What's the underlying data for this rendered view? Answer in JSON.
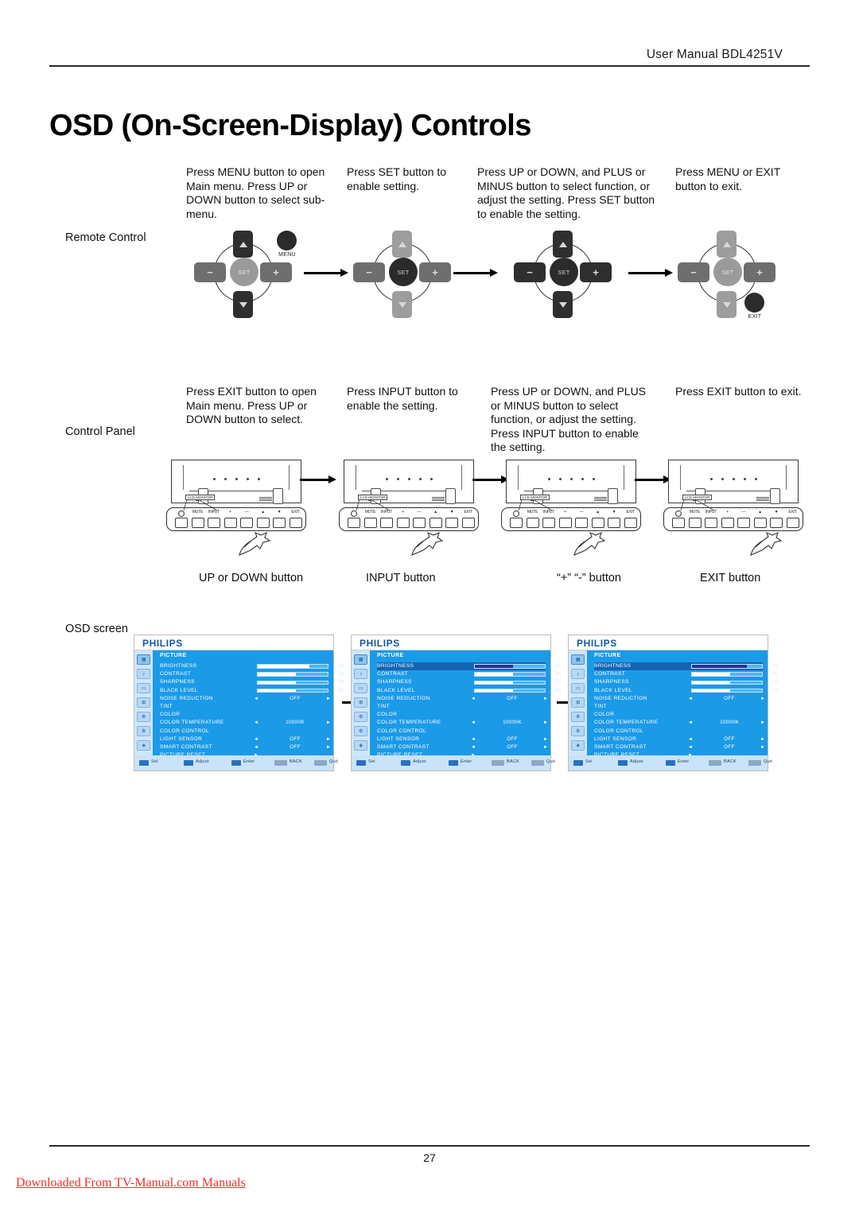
{
  "header": {
    "manual_line": "User Manual BDL4251V",
    "title": "OSD (On-Screen-Display) Controls"
  },
  "remote_section": {
    "row_label": "Remote Control",
    "steps": [
      "Press MENU button to open Main menu.   Press UP or DOWN button to select sub-menu.",
      "Press SET button to enable setting.",
      "Press UP or DOWN, and PLUS or MINUS button to select function, or adjust the setting. Press SET button to enable the setting.",
      "Press MENU or EXIT button to exit."
    ],
    "remotes": [
      {
        "extra_button": "MENU",
        "keys": {
          "up": "up-arrow",
          "down": "down-arrow",
          "left": "minus",
          "right": "plus",
          "center": "SET"
        }
      },
      {
        "extra_button": "",
        "keys": {
          "up": "up-arrow",
          "down": "down-arrow",
          "left": "minus",
          "right": "plus",
          "center": "SET"
        }
      },
      {
        "extra_button": "",
        "keys": {
          "up": "up-arrow",
          "down": "down-arrow",
          "left": "minus",
          "right": "plus",
          "center": "SET"
        }
      },
      {
        "extra_button": "EXIT",
        "keys": {
          "up": "up-arrow",
          "down": "down-arrow",
          "left": "minus",
          "right": "plus",
          "center": "SET"
        }
      }
    ]
  },
  "panel_section": {
    "row_label": "Control Panel",
    "steps": [
      "Press EXIT button to open Main menu. Press UP or DOWN button to select.",
      "Press INPUT button to enable the setting.",
      "Press UP or DOWN, and PLUS or MINUS button to select function, or adjust the setting. Press INPUT button to enable the setting.",
      "Press EXIT button to exit."
    ],
    "panel_buttons": [
      "⏻",
      "MUTE",
      "INPUT",
      "+",
      "—",
      "▲",
      "▼",
      "EXIT"
    ],
    "panel_tag": "LCD MONITOR",
    "captions": [
      "UP or DOWN button",
      "INPUT button",
      "“+” “-” button",
      "EXIT button"
    ]
  },
  "osd_section": {
    "row_label": "OSD screen",
    "brand": "PHILIPS",
    "menu_title": "PICTURE",
    "sidebar_icons": [
      "picture-icon",
      "audio-icon",
      "screen-icon",
      "pip-icon",
      "configuration1-icon",
      "configuration2-icon",
      "advanced-option-icon"
    ],
    "footer_keys": [
      {
        "chip": "updown-chip",
        "label": "Sel"
      },
      {
        "chip": "leftright-chip",
        "label": "Adjust"
      },
      {
        "chip": "set-chip",
        "label": "Enter"
      },
      {
        "chip": "exit-chip",
        "label": "BACK"
      },
      {
        "chip": "menu-chip",
        "label": "Quit"
      }
    ],
    "rows": [
      {
        "label": "BRIGHTNESS",
        "kind": "bar",
        "value": "50"
      },
      {
        "label": "CONTRAST",
        "kind": "bar",
        "value": "50"
      },
      {
        "label": "SHARPNESS",
        "kind": "bar",
        "value": "50"
      },
      {
        "label": "BLACK LEVEL",
        "kind": "bar",
        "value": "50"
      },
      {
        "label": "NOISE REDUCTION",
        "kind": "option",
        "value": "OFF"
      },
      {
        "label": "TINT",
        "kind": "plain",
        "value": ""
      },
      {
        "label": "COLOR",
        "kind": "plain",
        "value": ""
      },
      {
        "label": "COLOR TEMPERATURE",
        "kind": "option",
        "value": "10000K"
      },
      {
        "label": "COLOR CONTROL",
        "kind": "plain",
        "value": ""
      },
      {
        "label": "LIGHT SENSOR",
        "kind": "option",
        "value": "OFF"
      },
      {
        "label": "SMART CONTRAST",
        "kind": "option",
        "value": "OFF"
      },
      {
        "label": "PICTURE RESET",
        "kind": "submenu",
        "value": ""
      }
    ],
    "screens": [
      {
        "name": "osd-screen-1",
        "highlight_row": -1,
        "brightness_value": "50",
        "brightness_pct": 74,
        "brightness_selected": false
      },
      {
        "name": "osd-screen-2",
        "highlight_row": 0,
        "brightness_value": "50",
        "brightness_pct": 55,
        "brightness_selected": true
      },
      {
        "name": "osd-screen-3",
        "highlight_row": 0,
        "brightness_value": "70",
        "brightness_pct": 78,
        "brightness_selected": true
      }
    ],
    "bar_defaults": {
      "contrast_pct": 55,
      "sharpness_pct": 55,
      "black_level_pct": 55
    }
  },
  "footer": {
    "page_number": "27",
    "download_note": "Downloaded From TV-Manual.com Manuals"
  }
}
